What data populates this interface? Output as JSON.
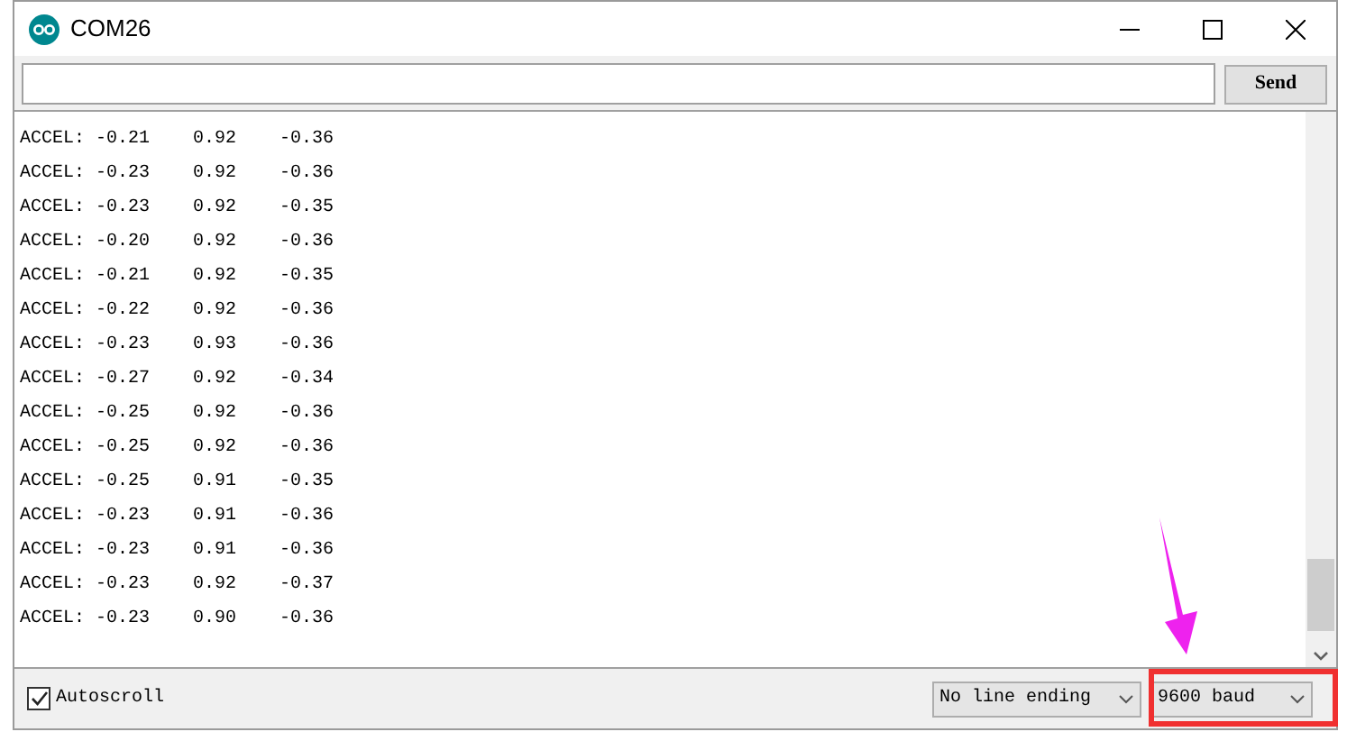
{
  "window": {
    "title": "COM26"
  },
  "send": {
    "button": "Send"
  },
  "output": [
    {
      "label": "ACCEL:",
      "values": [
        "-0.21",
        "0.92",
        "-0.36"
      ]
    },
    {
      "label": "ACCEL:",
      "values": [
        "-0.23",
        "0.92",
        "-0.36"
      ]
    },
    {
      "label": "ACCEL:",
      "values": [
        "-0.23",
        "0.92",
        "-0.35"
      ]
    },
    {
      "label": "ACCEL:",
      "values": [
        "-0.20",
        "0.92",
        "-0.36"
      ]
    },
    {
      "label": "ACCEL:",
      "values": [
        "-0.21",
        "0.92",
        "-0.35"
      ]
    },
    {
      "label": "ACCEL:",
      "values": [
        "-0.22",
        "0.92",
        "-0.36"
      ]
    },
    {
      "label": "ACCEL:",
      "values": [
        "-0.23",
        "0.93",
        "-0.36"
      ]
    },
    {
      "label": "ACCEL:",
      "values": [
        "-0.27",
        "0.92",
        "-0.34"
      ]
    },
    {
      "label": "ACCEL:",
      "values": [
        "-0.25",
        "0.92",
        "-0.36"
      ]
    },
    {
      "label": "ACCEL:",
      "values": [
        "-0.25",
        "0.92",
        "-0.36"
      ]
    },
    {
      "label": "ACCEL:",
      "values": [
        "-0.25",
        "0.91",
        "-0.35"
      ]
    },
    {
      "label": "ACCEL:",
      "values": [
        "-0.23",
        "0.91",
        "-0.36"
      ]
    },
    {
      "label": "ACCEL:",
      "values": [
        "-0.23",
        "0.91",
        "-0.36"
      ]
    },
    {
      "label": "ACCEL:",
      "values": [
        "-0.23",
        "0.92",
        "-0.37"
      ]
    },
    {
      "label": "ACCEL:",
      "values": [
        "-0.23",
        "0.90",
        "-0.36"
      ]
    }
  ],
  "autoscroll": {
    "label": "Autoscroll",
    "checked": true
  },
  "line_ending": {
    "value": "No line ending"
  },
  "baud": {
    "value": "9600 baud",
    "highlighted": true
  }
}
